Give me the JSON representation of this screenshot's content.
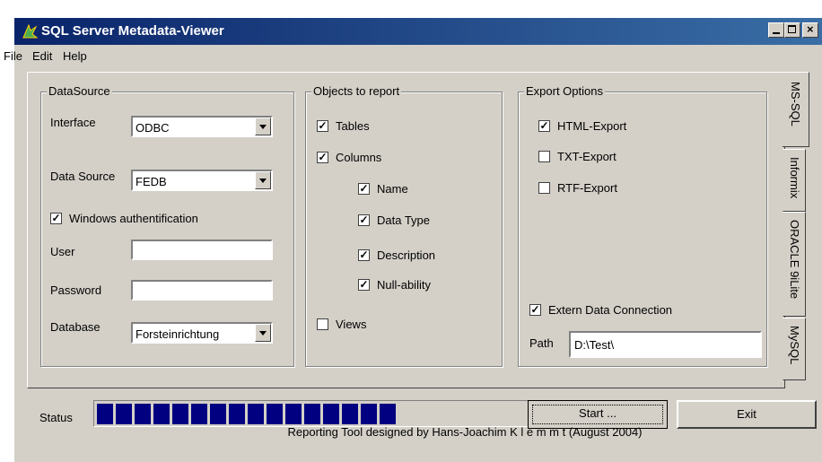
{
  "window": {
    "title": "SQL Server Metadata-Viewer"
  },
  "menu": [
    "File",
    "Edit",
    "Help"
  ],
  "datasource": {
    "legend": "DataSource",
    "interface_label": "Interface",
    "interface_value": "ODBC",
    "datasource_label": "Data Source",
    "datasource_value": "FEDB",
    "winauth_label": "Windows authentification",
    "winauth_checked": true,
    "user_label": "User",
    "user_value": "",
    "password_label": "Password",
    "password_value": "",
    "database_label": "Database",
    "database_value": "Forsteinrichtung"
  },
  "objects": {
    "legend": "Objects to report",
    "tables": "Tables",
    "columns": "Columns",
    "name": "Name",
    "datatype": "Data Type",
    "description": "Description",
    "nullability": "Null-ability",
    "views": "Views"
  },
  "export": {
    "legend": "Export Options",
    "html": "HTML-Export",
    "txt": "TXT-Export",
    "rtf": "RTF-Export",
    "extern": "Extern Data Connection",
    "path_label": "Path",
    "path_value": "D:\\Test\\"
  },
  "tabs": [
    "MS-SQL",
    "Informix",
    "ORACLE 9iLite",
    "MySQL"
  ],
  "status": {
    "label": "Status",
    "progress_blocks": 16
  },
  "buttons": {
    "start": "Start ...",
    "exit": "Exit"
  },
  "footer": "Reporting Tool designed by Hans-Joachim K l e m m t (August 2004)"
}
